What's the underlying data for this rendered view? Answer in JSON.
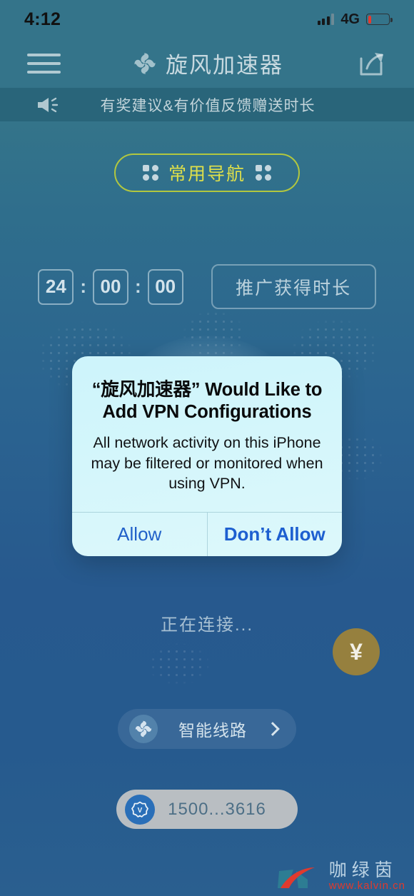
{
  "status_bar": {
    "time": "4:12",
    "network": "4G",
    "signal_icon": "signal-bars-icon",
    "battery_icon": "battery-low-icon"
  },
  "header": {
    "menu_icon": "hamburger-menu-icon",
    "logo_icon": "swirl-logo-icon",
    "title": "旋风加速器",
    "share_icon": "share-icon"
  },
  "notice": {
    "icon": "megaphone-icon",
    "text": "有奖建议&有价值反馈赠送时长"
  },
  "nav_pill": {
    "label": "常用导航",
    "left_icon": "grid-dots-icon",
    "right_icon": "grid-dots-icon",
    "border_color": "#b2c73f",
    "text_color": "#dfe04a"
  },
  "timer": {
    "hours": "24",
    "minutes": "00",
    "seconds": "00",
    "separator": ":",
    "promo_button": "推广获得时长"
  },
  "alert": {
    "title": "“旋风加速器” Would Like to Add VPN Configurations",
    "message": "All network activity on this iPhone may be filtered or monitored when using VPN.",
    "allow_label": "Allow",
    "deny_label": "Don’t Allow",
    "background_color": "#d4f6fb",
    "action_color": "#2161c9"
  },
  "connection": {
    "status_text": "正在连接..."
  },
  "coin_button": {
    "symbol": "¥",
    "icon": "yuan-coin-icon",
    "color": "#96803e"
  },
  "route": {
    "icon": "swirl-logo-icon",
    "label": "智能线路",
    "chevron_icon": "chevron-right-icon"
  },
  "account": {
    "icon": "vip-badge-icon",
    "label": "1500...3616"
  },
  "watermark": {
    "logo_icon": "kalvin-logo-icon",
    "name": "咖绿茵",
    "url": "www.kalvin.cn"
  }
}
